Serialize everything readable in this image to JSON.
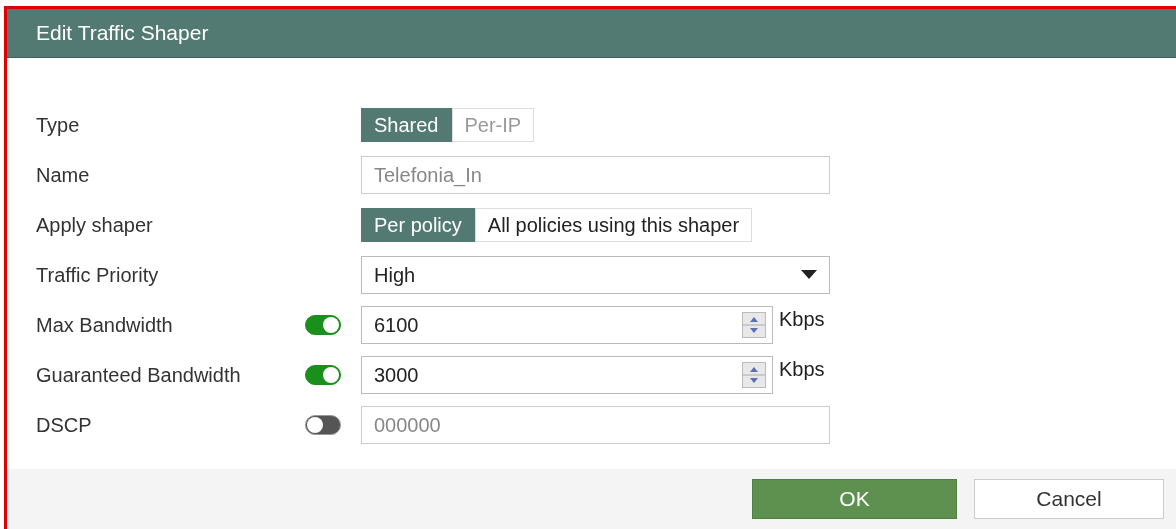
{
  "window": {
    "title": "Edit Traffic Shaper"
  },
  "rows": [
    {
      "kind": "segmented",
      "label": "Type",
      "options": [
        {
          "label": "Shared",
          "selected": true
        },
        {
          "label": "Per-IP",
          "selected": false
        }
      ],
      "disabled": true
    },
    {
      "kind": "text",
      "label": "Name",
      "value": "Telefonia_In",
      "disabled": true
    },
    {
      "kind": "segmented",
      "label": "Apply shaper",
      "options": [
        {
          "label": "Per policy",
          "selected": true
        },
        {
          "label": "All policies using this shaper",
          "selected": false
        }
      ],
      "disabled": false
    },
    {
      "kind": "select",
      "label": "Traffic Priority",
      "value": "High"
    },
    {
      "kind": "number",
      "label": "Max Bandwidth",
      "on": true,
      "value": "6100",
      "unit": "Kbps"
    },
    {
      "kind": "number",
      "label": "Guaranteed Bandwidth",
      "on": true,
      "value": "3000",
      "unit": "Kbps"
    },
    {
      "kind": "text",
      "label": "DSCP",
      "on": false,
      "value": "000000",
      "disabled": true
    }
  ],
  "buttons": [
    {
      "label": "OK",
      "kind": "primary"
    },
    {
      "label": "Cancel",
      "kind": "secondary"
    }
  ]
}
